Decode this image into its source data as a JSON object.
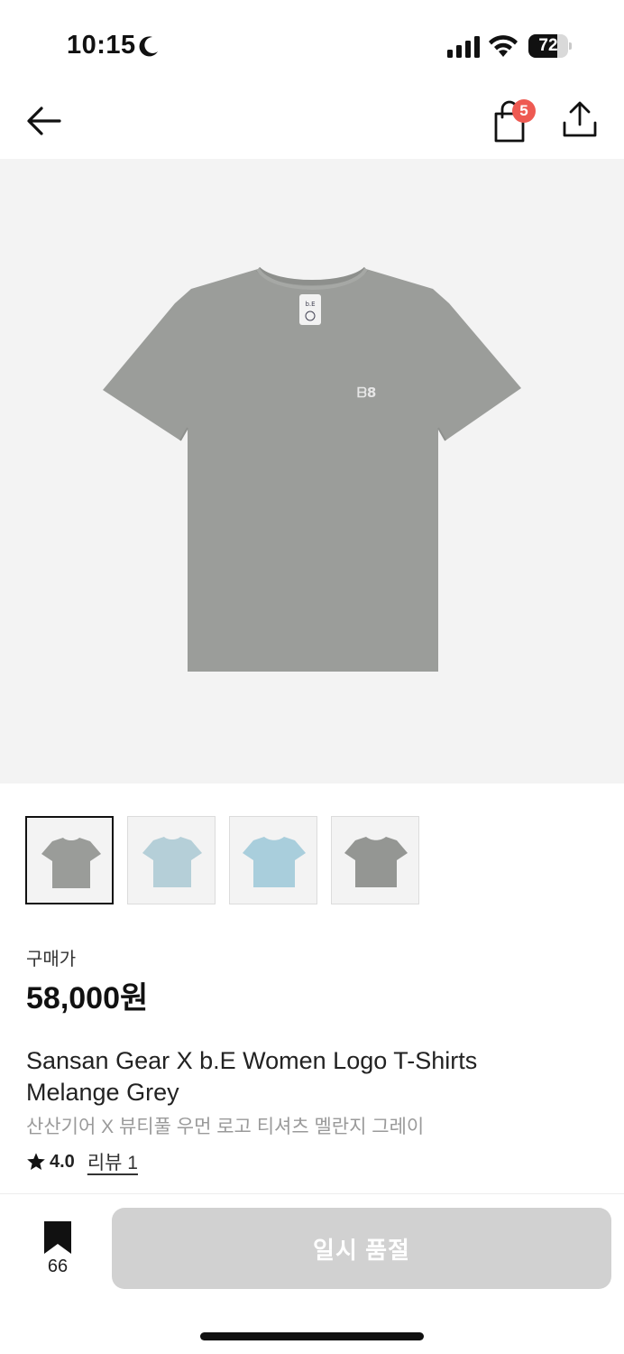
{
  "status_bar": {
    "time": "10:15",
    "battery_level": "72",
    "battery_fraction": 0.72,
    "icons": [
      "moon-icon",
      "signal-icon",
      "wifi-icon",
      "battery-icon"
    ]
  },
  "nav": {
    "back_icon": "arrow-left-icon",
    "cart_icon": "shopping-bag-icon",
    "cart_count": "5",
    "share_icon": "share-upload-icon"
  },
  "product": {
    "main_image_icon": "tshirt-image",
    "thumbnails": [
      {
        "name": "melange-grey",
        "color": "#9a9c99",
        "selected": true
      },
      {
        "name": "light-blue-1",
        "color": "#b5cfd8",
        "selected": false
      },
      {
        "name": "light-blue-2",
        "color": "#a9cedc",
        "selected": false
      },
      {
        "name": "grey-2",
        "color": "#949693",
        "selected": false
      }
    ],
    "price_label": "구매가",
    "price": "58,000원",
    "title_en_line1": "Sansan Gear X b.E Women Logo T-Shirts",
    "title_en_line2": "Melange Grey",
    "title_ko": "산산기어 X 뷰티풀 우먼 로고 티셔츠 멜란지 그레이",
    "rating": "4.0",
    "review_label": "리뷰 1"
  },
  "bottom_bar": {
    "bookmark_count": "66",
    "button_label": "일시 품절"
  },
  "colors": {
    "badge": "#ee5a52",
    "shirt": "#9b9d9a",
    "button_disabled": "#d1d1d1",
    "image_bg": "#f3f3f3"
  }
}
